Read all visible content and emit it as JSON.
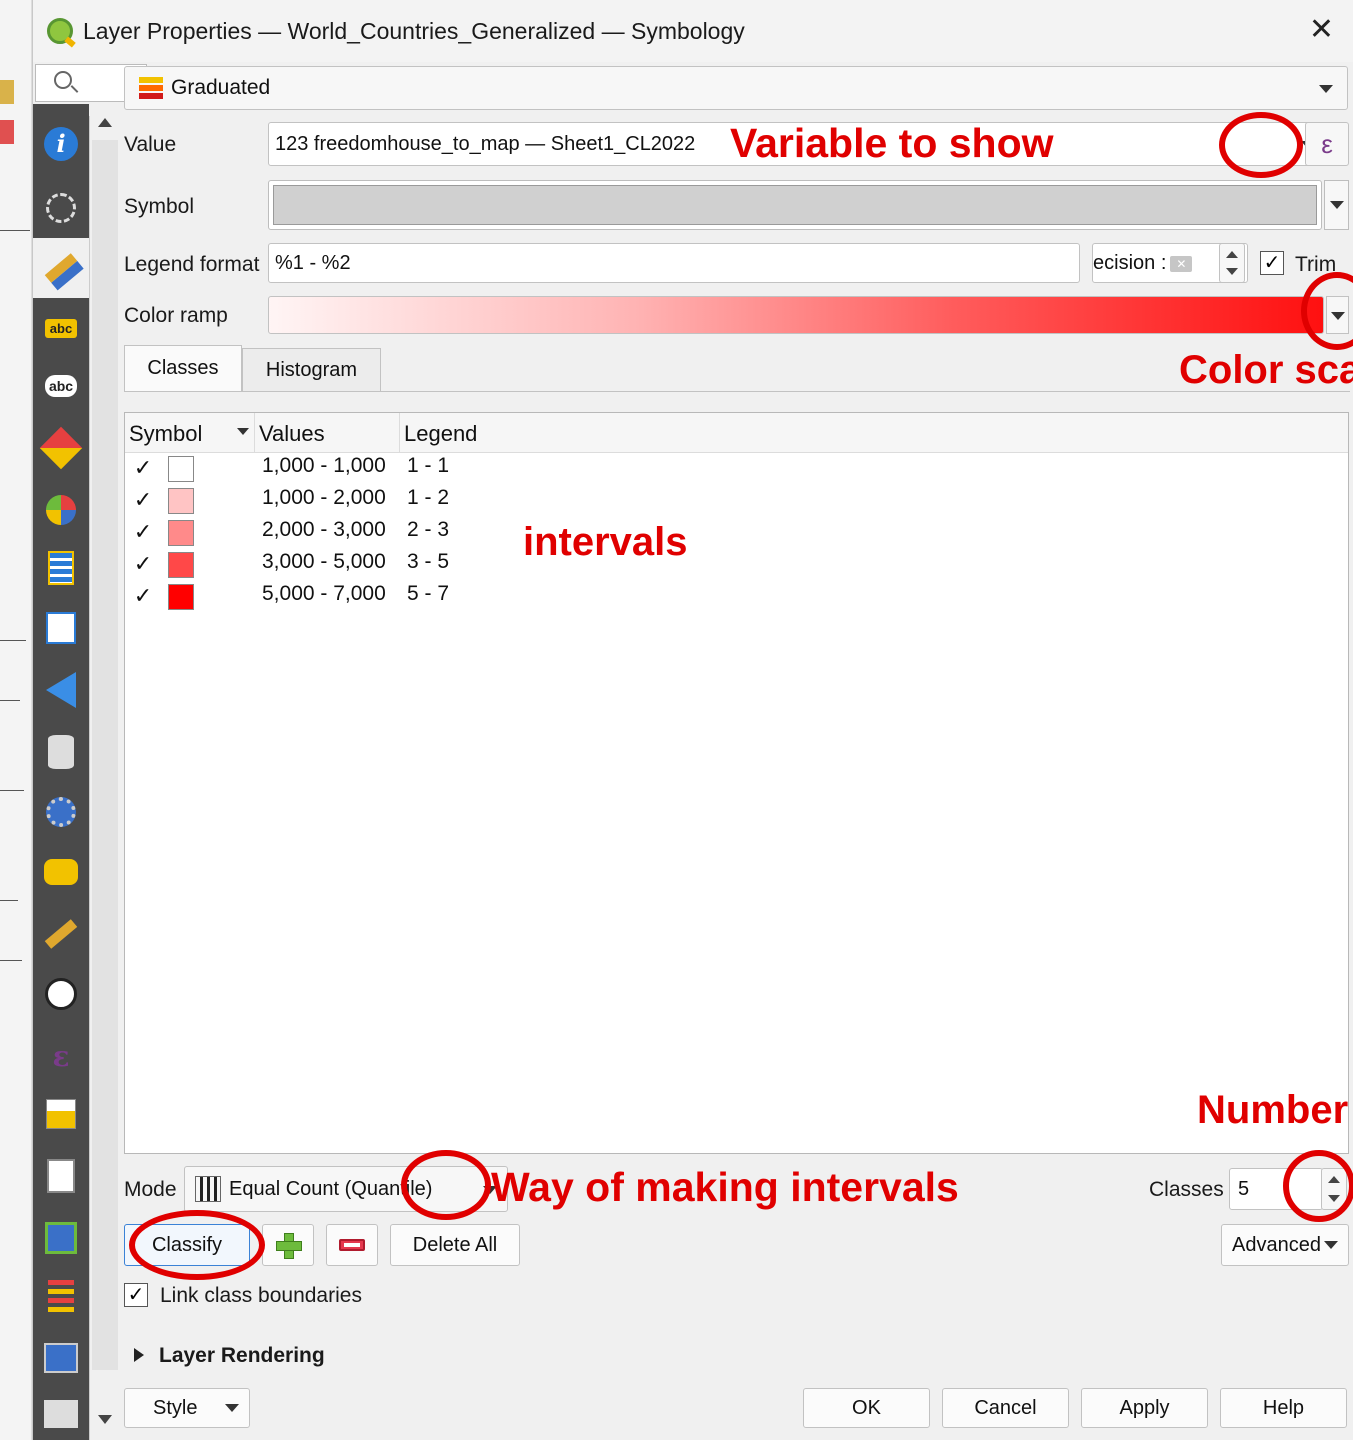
{
  "window": {
    "title": "Layer Properties — World_Countries_Generalized — Symbology",
    "close_glyph": "✕"
  },
  "renderer": {
    "selected": "Graduated",
    "icon": "graduated-renderer-icon"
  },
  "value_field": {
    "label": "Value",
    "text": "123 freedomhouse_to_map — Sheet1_CL2022",
    "expression_glyph": "ε"
  },
  "symbol": {
    "label": "Symbol",
    "color": "#d0d0d0"
  },
  "legend_format": {
    "label": "Legend format",
    "value": "%1 - %2",
    "precision_text": "ecision :",
    "trim_label": "Trim",
    "trim_checked": true
  },
  "color_ramp": {
    "label": "Color ramp",
    "start_color": "#fff5f5",
    "end_color": "#ff1010"
  },
  "tabs": [
    {
      "label": "Classes",
      "active": true
    },
    {
      "label": "Histogram",
      "active": false
    }
  ],
  "table": {
    "columns": [
      "Symbol",
      "Values",
      "Legend"
    ],
    "rows": [
      {
        "checked": "✓",
        "color": "#ffffff",
        "values": "1,000 - 1,000",
        "legend": "1 - 1"
      },
      {
        "checked": "✓",
        "color": "#ffc4c4",
        "values": "1,000 - 2,000",
        "legend": "1 - 2"
      },
      {
        "checked": "✓",
        "color": "#ff8a8a",
        "values": "2,000 - 3,000",
        "legend": "2 - 3"
      },
      {
        "checked": "✓",
        "color": "#ff4848",
        "values": "3,000 - 5,000",
        "legend": "3 - 5"
      },
      {
        "checked": "✓",
        "color": "#ff0000",
        "values": "5,000 - 7,000",
        "legend": "5 - 7"
      }
    ]
  },
  "mode": {
    "label": "Mode",
    "value": "Equal Count (Quantile)"
  },
  "classes": {
    "label": "Classes",
    "value": "5"
  },
  "buttons": {
    "classify": "Classify",
    "delete_all": "Delete All",
    "advanced": "Advanced",
    "style": "Style",
    "ok": "OK",
    "cancel": "Cancel",
    "apply": "Apply",
    "help": "Help"
  },
  "link_boundaries": {
    "label": "Link class boundaries",
    "checked": "✓"
  },
  "layer_rendering": {
    "label": "Layer Rendering"
  },
  "annotations": {
    "variable": "Variable to show",
    "color_scale": "Color sca",
    "intervals": "intervals",
    "number": "Number",
    "way": "Way of making intervals",
    "color": "#e00000"
  },
  "sidebar_icons": [
    "information-icon",
    "source-icon",
    "symbology-icon",
    "labels-icon",
    "masks-icon",
    "3d-view-icon",
    "diagrams-icon",
    "fields-icon",
    "attributes-form-icon",
    "joins-icon",
    "auxiliary-storage-icon",
    "actions-icon",
    "display-icon",
    "rendering-icon",
    "temporal-icon",
    "variables-icon",
    "elevation-icon",
    "metadata-icon",
    "dependencies-icon",
    "legend-icon",
    "server-icon",
    "digitizing-icon"
  ]
}
